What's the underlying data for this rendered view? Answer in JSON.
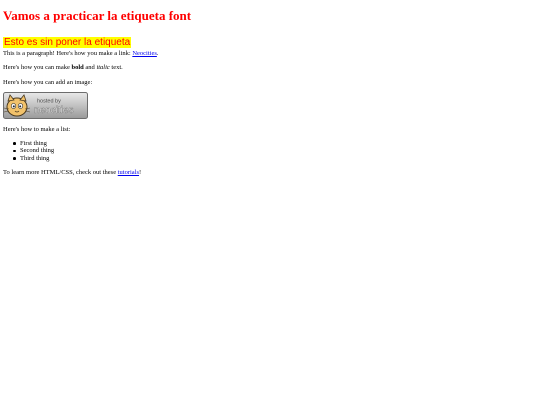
{
  "heading": "Vamos a practicar la etiqueta font",
  "highlight_text": "Esto es sin poner la etiqueta",
  "paragraph_link": {
    "before": "This is a paragraph! Here's how you make a link: ",
    "link": "Neocities",
    "after": "."
  },
  "paragraph_format": {
    "before": "Here's how you can make ",
    "bold": "bold",
    "middle": " and ",
    "italic": "italic",
    "after": " text."
  },
  "image_intro": "Here's how you can add an image:",
  "badge": {
    "line1": "hosted by",
    "line2": "neocities"
  },
  "list_intro": "Here's how to make a list:",
  "list_items": [
    "First thing",
    "Second thing",
    "Third thing"
  ],
  "learn_more": {
    "before": "To learn more HTML/CSS, check out these ",
    "link": "tutorials",
    "after": "!"
  },
  "colors": {
    "heading": "#ff0000",
    "highlight_bg": "#ffff00",
    "link": "#0000ee"
  },
  "icons": {
    "badge_mascot": "neocities-cat-icon"
  }
}
